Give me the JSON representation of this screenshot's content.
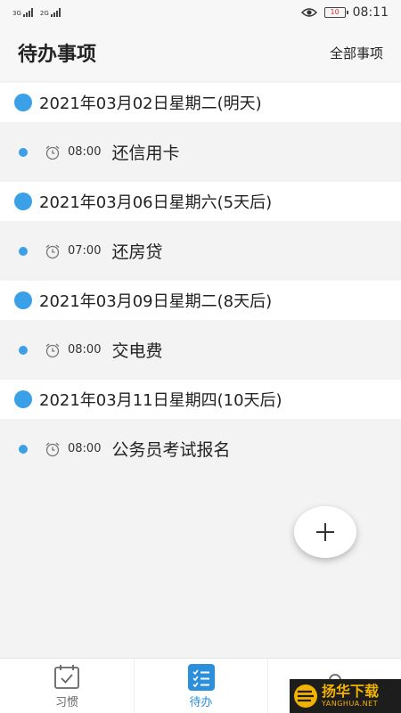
{
  "status_bar": {
    "net1_label": "3G",
    "net2_label": "2G",
    "battery_level": "10",
    "time": "08:11"
  },
  "header": {
    "title": "待办事项",
    "all_items_label": "全部事项"
  },
  "groups": [
    {
      "date": "2021年03月02日星期二(明天)",
      "todo": {
        "time": "08:00",
        "title": "还信用卡"
      }
    },
    {
      "date": "2021年03月06日星期六(5天后)",
      "todo": {
        "time": "07:00",
        "title": "还房贷"
      }
    },
    {
      "date": "2021年03月09日星期二(8天后)",
      "todo": {
        "time": "08:00",
        "title": "交电费"
      }
    },
    {
      "date": "2021年03月11日星期四(10天后)",
      "todo": {
        "time": "08:00",
        "title": "公务员考试报名"
      }
    }
  ],
  "bottom_nav": {
    "tabs": [
      {
        "label": "习惯",
        "icon": "calendar-check-icon"
      },
      {
        "label": "待办",
        "icon": "checklist-icon"
      },
      {
        "label": "",
        "icon": "user-icon"
      }
    ],
    "active_index": 1
  },
  "watermark": {
    "cn": "扬华下载",
    "en": "YANGHUA.NET"
  },
  "colors": {
    "accent": "#3aa0e8",
    "active_tab": "#2b8fdb",
    "background": "#f3f3f3",
    "date_row_bg": "#ffffff",
    "watermark_gold": "#f2b200"
  }
}
